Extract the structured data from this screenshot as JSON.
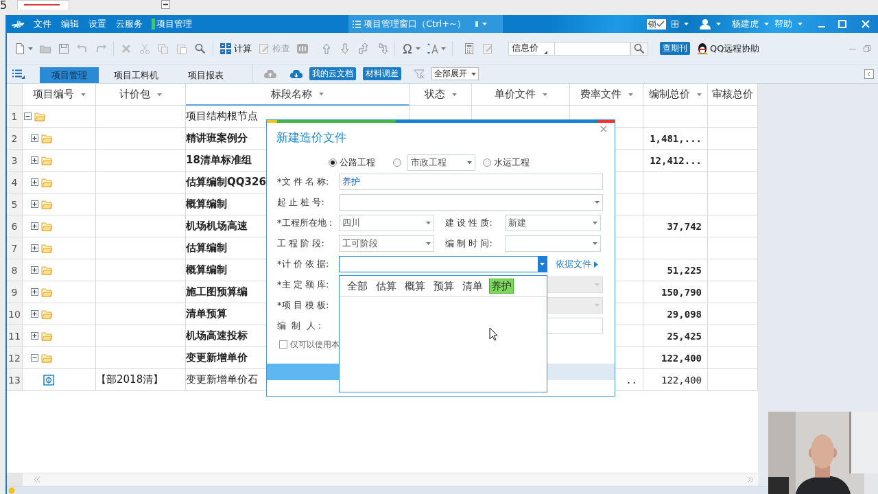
{
  "top_strip": {
    "label": "5"
  },
  "menu_bar": {
    "items": [
      {
        "label": "文件",
        "active": false
      },
      {
        "label": "编辑",
        "active": false
      },
      {
        "label": "设置",
        "active": false
      },
      {
        "label": "云服务",
        "active": false
      },
      {
        "label": "项目管理",
        "active": true
      }
    ],
    "window_tab": "项目管理窗口（Ctrl+~）",
    "lock": "锁",
    "user": "杨建虎",
    "help": "帮助"
  },
  "toolbar": {
    "buttons": [
      {
        "label": "计算",
        "disabled": false
      },
      {
        "label": "检查",
        "disabled": true
      }
    ],
    "search_scope": "信息价",
    "journal_button": "查期刊",
    "remote_help": "QQ远程协助"
  },
  "tabs": [
    {
      "label": "项目管理",
      "selected": true
    },
    {
      "label": "项目工料机",
      "selected": false
    },
    {
      "label": "项目报表",
      "selected": false
    }
  ],
  "cloud_buttons": [
    "我的云文档",
    "材料调差"
  ],
  "expand_select": "全部展开",
  "table": {
    "columns": [
      "项目编号",
      "计价包",
      "标段名称",
      "状态",
      "单价文件",
      "费率文件",
      "编制总价",
      "审核总价"
    ],
    "rows": [
      {
        "number": "1",
        "kind": "folder",
        "expanded": true,
        "name": "项目结构根节点",
        "bold": false,
        "children": [
          {
            "number": "2",
            "kind": "folder",
            "expanded": false,
            "name": "精讲班案例分",
            "bold": true,
            "total": "1,481,..."
          },
          {
            "number": "3",
            "kind": "folder",
            "expanded": false,
            "name": "18清单标准组",
            "bold": true,
            "total": "12,412..."
          },
          {
            "number": "4",
            "kind": "folder",
            "expanded": false,
            "name": "估算编制QQ326",
            "bold": true
          },
          {
            "number": "5",
            "kind": "folder",
            "expanded": false,
            "name": "概算编制",
            "bold": true
          },
          {
            "number": "6",
            "kind": "folder",
            "expanded": false,
            "name": "机场机场高速",
            "bold": true,
            "total": "37,742"
          },
          {
            "number": "7",
            "kind": "folder",
            "expanded": false,
            "name": "估算编制",
            "bold": true
          },
          {
            "number": "8",
            "kind": "folder",
            "expanded": false,
            "name": "概算编制",
            "bold": true,
            "total": "51,225"
          },
          {
            "number": "9",
            "kind": "folder",
            "expanded": false,
            "name": "施工图预算编",
            "bold": true,
            "total": "150,790"
          },
          {
            "number": "10",
            "kind": "folder",
            "expanded": false,
            "name": "清单预算",
            "bold": true,
            "total": "29,098"
          },
          {
            "number": "11",
            "kind": "folder",
            "expanded": false,
            "name": "机场高速投标",
            "bold": true,
            "total": "25,425"
          },
          {
            "number": "12",
            "kind": "folder",
            "expanded": true,
            "name": "变更新增单价",
            "bold": true,
            "total": "122,400",
            "children": [
              {
                "number": "13",
                "kind": "file",
                "package": "【部2018清】",
                "name": "变更新增单价石",
                "bold": false,
                "fee_file": "..",
                "total": "122,400"
              }
            ]
          }
        ]
      }
    ]
  },
  "dialog": {
    "title": "新建造价文件",
    "project_types": [
      {
        "label": "公路工程",
        "kind": "radio",
        "selected": true
      },
      {
        "label": "市政工程",
        "kind": "select",
        "selected": false
      },
      {
        "label": "水运工程",
        "kind": "radio",
        "selected": false
      }
    ],
    "field_rows": [
      [
        {
          "label": "*文 件 名 称:",
          "kind": "text",
          "value": "养护",
          "disabled": false,
          "open": false
        }
      ],
      [
        {
          "label": "起 止 桩 号:",
          "kind": "select",
          "disabled": false,
          "open": false
        }
      ],
      [
        {
          "label": "*工程所在地 :",
          "kind": "select",
          "value": "四川",
          "disabled": false,
          "open": false
        },
        {
          "label": "建 设 性 质:",
          "kind": "select",
          "value": "新建",
          "disabled": false,
          "open": false
        }
      ],
      [
        {
          "label": "工 程 阶 段:",
          "kind": "select",
          "value": "工可阶段",
          "disabled": false,
          "open": false
        },
        {
          "label": "编 制 时 间:",
          "kind": "select",
          "disabled": false,
          "open": false
        }
      ],
      [
        {
          "label": "*计 价 依 据:",
          "kind": "select",
          "disabled": false,
          "open": true,
          "link": "依据文件"
        }
      ],
      [
        {
          "label": "*主 定 额 库:",
          "kind": "select",
          "disabled": true,
          "open": false
        }
      ],
      [
        {
          "label": "*项 目 模 板:",
          "kind": "select",
          "disabled": true,
          "open": false
        }
      ],
      [
        {
          "label": "编  制  人 :",
          "kind": "text",
          "disabled": false,
          "open": false
        }
      ]
    ],
    "checkbox": {
      "label": "仅可以使用本",
      "checked": false
    },
    "dropdown_filters": [
      {
        "label": "全部",
        "selected": false
      },
      {
        "label": "估算",
        "selected": false
      },
      {
        "label": "概算",
        "selected": false
      },
      {
        "label": "预算",
        "selected": false
      },
      {
        "label": "清单",
        "selected": false
      },
      {
        "label": "养护",
        "selected": true
      }
    ]
  }
}
